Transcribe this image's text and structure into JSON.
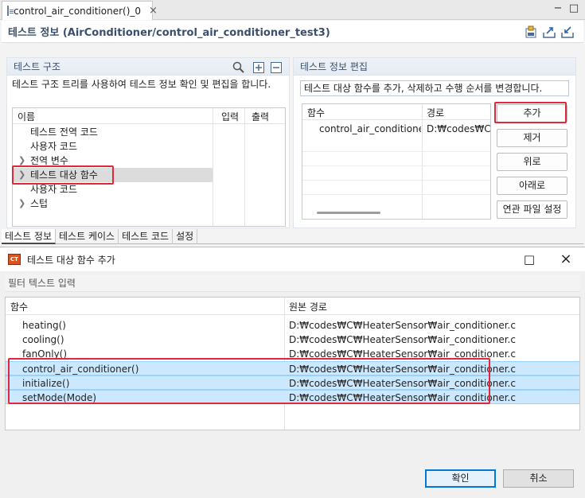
{
  "editor": {
    "tab_title": "control_air_conditioner()_0",
    "tab_close": "×",
    "minimize": "−",
    "maximize": "□",
    "form_title": "테스트 정보 (AirConditioner/control_air_conditioner_test3)",
    "toolbar_icons": [
      "save-icon",
      "export-icon",
      "import-icon"
    ],
    "left_section": {
      "title": "테스트 구조",
      "description": "테스트 구조 트리를 사용하여 테스트 정보 확인 및 편집을 합니다.",
      "columns": [
        "이름",
        "입력",
        "출력"
      ],
      "rows": [
        {
          "label": "테스트 전역 코드",
          "expandable": false
        },
        {
          "label": "사용자 코드",
          "expandable": false
        },
        {
          "label": "전역 변수",
          "expandable": true
        },
        {
          "label": "테스트 대상 함수",
          "expandable": true,
          "selected": true
        },
        {
          "label": "사용자 코드",
          "expandable": false
        },
        {
          "label": "스텁",
          "expandable": true
        }
      ]
    },
    "right_section": {
      "title": "테스트 정보 편집",
      "description": "테스트 대상 함수를 추가, 삭제하고 수행 순서를 변경합니다.",
      "columns": [
        "함수",
        "경로"
      ],
      "rows": [
        {
          "function": "control_air_conditioner()",
          "path": "D:₩codes₩C₩He"
        }
      ],
      "buttons": [
        "추가",
        "제거",
        "위로",
        "아래로",
        "연관 파일 설정"
      ]
    },
    "bottom_tabs": [
      "테스트 정보",
      "테스트 케이스",
      "테스트 코드",
      "설정"
    ],
    "active_bottom_tab": "테스트 정보"
  },
  "dialog": {
    "title": "테스트 대상 함수 추가",
    "app_icon_text": "CT",
    "maximize": "□",
    "close": "×",
    "filter_placeholder": "필터 텍스트 입력",
    "columns": [
      "함수",
      "원본 경로"
    ],
    "rows": [
      {
        "function": "heating()",
        "path": "D:₩codes₩C₩HeaterSensor₩air_conditioner.c",
        "selected": false
      },
      {
        "function": "cooling()",
        "path": "D:₩codes₩C₩HeaterSensor₩air_conditioner.c",
        "selected": false
      },
      {
        "function": "fanOnly()",
        "path": "D:₩codes₩C₩HeaterSensor₩air_conditioner.c",
        "selected": false
      },
      {
        "function": "control_air_conditioner()",
        "path": "D:₩codes₩C₩HeaterSensor₩air_conditioner.c",
        "selected": true
      },
      {
        "function": "initialize()",
        "path": "D:₩codes₩C₩HeaterSensor₩air_conditioner.c",
        "selected": true
      },
      {
        "function": "setMode(Mode)",
        "path": "D:₩codes₩C₩HeaterSensor₩air_conditioner.c",
        "selected": true
      }
    ],
    "ok_label": "확인",
    "cancel_label": "취소"
  },
  "colors": {
    "highlight": "#e0283c",
    "selection": "#cce8ff",
    "header_text": "#3b4e6b"
  }
}
